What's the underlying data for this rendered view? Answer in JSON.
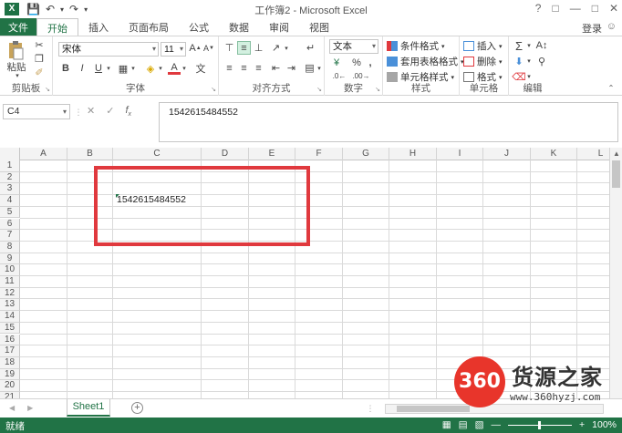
{
  "window": {
    "title": "工作簿2 - Microsoft Excel",
    "login": "登录",
    "app_icon_letter": "X"
  },
  "tabs": [
    {
      "label": "文件"
    },
    {
      "label": "开始"
    },
    {
      "label": "插入"
    },
    {
      "label": "页面布局"
    },
    {
      "label": "公式"
    },
    {
      "label": "数据"
    },
    {
      "label": "审阅"
    },
    {
      "label": "视图"
    }
  ],
  "ribbon": {
    "clipboard": {
      "label": "剪贴板",
      "paste": "粘贴"
    },
    "font": {
      "label": "字体",
      "name": "宋体",
      "size": "11"
    },
    "alignment": {
      "label": "对齐方式"
    },
    "number": {
      "label": "数字",
      "format": "文本"
    },
    "styles": {
      "label": "样式",
      "conditional": "条件格式",
      "table": "套用表格格式",
      "cell": "单元格样式"
    },
    "cells": {
      "label": "单元格",
      "insert": "插入",
      "delete": "删除",
      "format": "格式"
    },
    "editing": {
      "label": "编辑"
    }
  },
  "formula_bar": {
    "name_box": "C4",
    "value": "1542615484552"
  },
  "columns": [
    "A",
    "B",
    "C",
    "D",
    "E",
    "F",
    "G",
    "H",
    "I",
    "J",
    "K",
    "L"
  ],
  "rows": [
    "1",
    "2",
    "3",
    "4",
    "5",
    "6",
    "7",
    "8",
    "9",
    "10",
    "11",
    "12",
    "13",
    "14",
    "15",
    "16",
    "17",
    "18",
    "19",
    "20",
    "21"
  ],
  "cells": {
    "C4": "1542615484552"
  },
  "sheets": [
    {
      "name": "Sheet1"
    }
  ],
  "status": {
    "mode": "就绪",
    "zoom": "100%"
  },
  "watermark": {
    "logo": "360",
    "name": "货源之家",
    "url": "www.360hyzj.com"
  },
  "colors": {
    "accent": "#217346",
    "highlight_box": "#e0393e",
    "watermark_red": "#e8352b"
  }
}
